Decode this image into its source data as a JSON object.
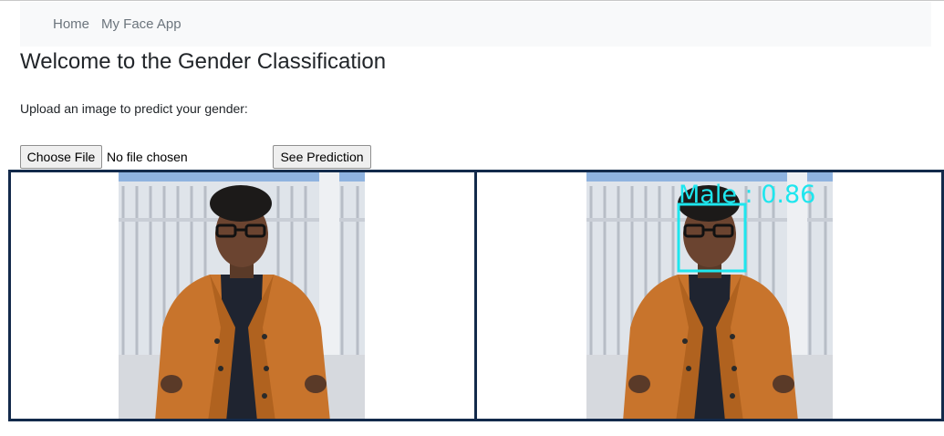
{
  "nav": {
    "items": [
      {
        "label": "Home"
      },
      {
        "label": "My Face App"
      }
    ]
  },
  "page": {
    "title": "Welcome to the Gender Classification",
    "upload_prompt": "Upload an image to predict your gender:"
  },
  "form": {
    "choose_file_label": "Choose File",
    "file_status": "No file chosen",
    "predict_label": "See Prediction"
  },
  "result": {
    "prediction_label": "Male :  0.86",
    "box_color": "#1ee6ee"
  },
  "colors": {
    "panel_border": "#132a4b",
    "coat": "#c8742c",
    "sky": "#8fb3e0"
  }
}
